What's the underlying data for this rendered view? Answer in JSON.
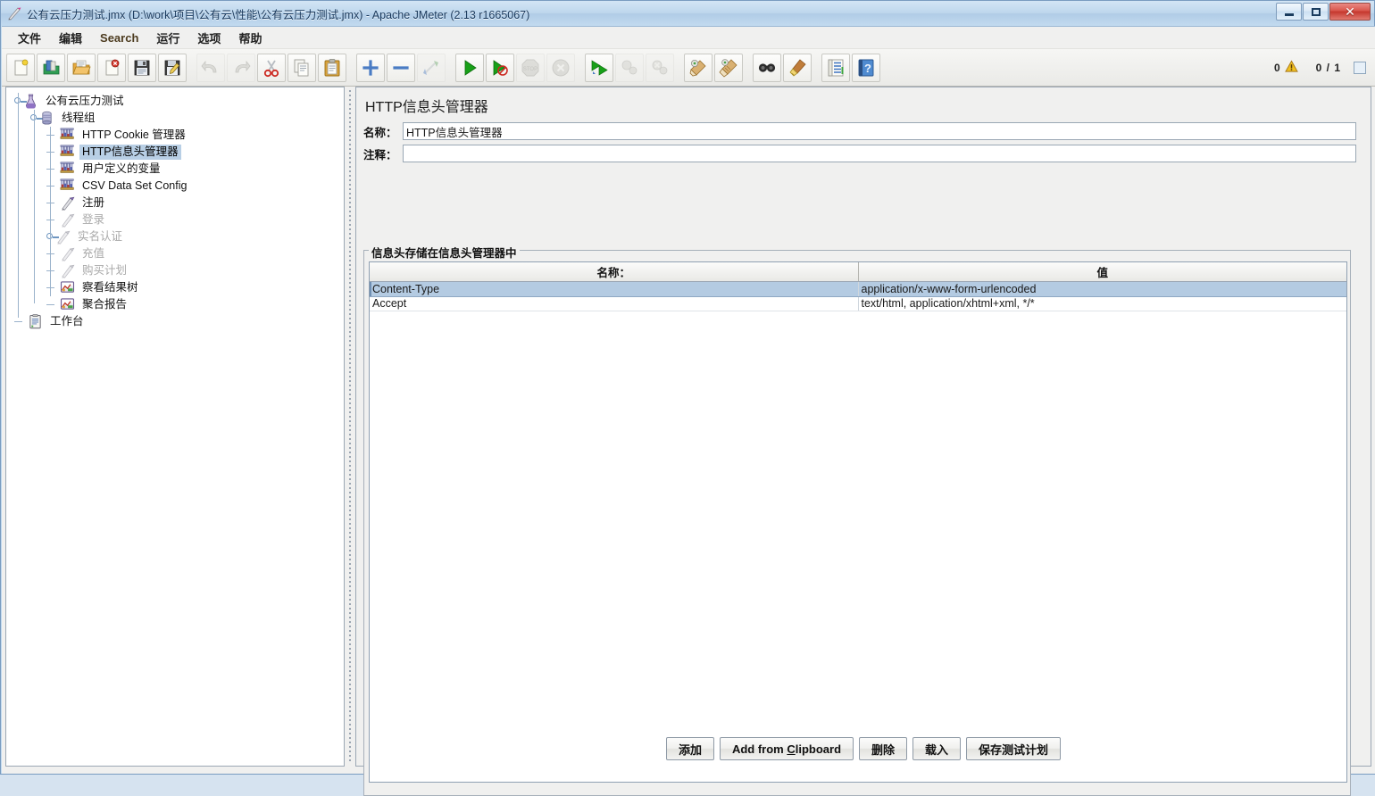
{
  "window": {
    "title": "公有云压力测试.jmx (D:\\work\\项目\\公有云\\性能\\公有云压力测试.jmx) - Apache JMeter (2.13 r1665067)",
    "minimize_label": "最小化",
    "maximize_label": "最大化",
    "close_label": "关闭"
  },
  "menubar": [
    {
      "label": "文件",
      "latin": false
    },
    {
      "label": "编辑",
      "latin": false
    },
    {
      "label": "Search",
      "latin": true
    },
    {
      "label": "运行",
      "latin": false
    },
    {
      "label": "选项",
      "latin": false
    },
    {
      "label": "帮助",
      "latin": false
    }
  ],
  "toolbar": {
    "buttons": [
      {
        "name": "new-icon",
        "disabled": false
      },
      {
        "name": "templates-icon",
        "disabled": false
      },
      {
        "name": "open-icon",
        "disabled": false
      },
      {
        "name": "close-icon",
        "disabled": false
      },
      {
        "name": "save-icon",
        "disabled": false
      },
      {
        "name": "save-as-icon",
        "disabled": false
      },
      {
        "name": "undo-icon",
        "disabled": true
      },
      {
        "name": "redo-icon",
        "disabled": true
      },
      {
        "name": "cut-icon",
        "disabled": false
      },
      {
        "name": "copy-icon",
        "disabled": false
      },
      {
        "name": "paste-icon",
        "disabled": false
      },
      {
        "name": "expand-all-icon",
        "disabled": false
      },
      {
        "name": "collapse-all-icon",
        "disabled": false
      },
      {
        "name": "toggle-icon",
        "disabled": true
      },
      {
        "name": "start-icon",
        "disabled": false
      },
      {
        "name": "start-no-timers-icon",
        "disabled": false
      },
      {
        "name": "stop-icon",
        "disabled": true
      },
      {
        "name": "shutdown-icon",
        "disabled": true
      },
      {
        "name": "remote-start-all-icon",
        "disabled": false
      },
      {
        "name": "remote-stop-all-icon",
        "disabled": true
      },
      {
        "name": "remote-shutdown-all-icon",
        "disabled": true
      },
      {
        "name": "clear-icon",
        "disabled": false
      },
      {
        "name": "clear-all-icon",
        "disabled": false
      },
      {
        "name": "search-icon",
        "disabled": false
      },
      {
        "name": "search-reset-icon",
        "disabled": false
      },
      {
        "name": "function-helper-icon",
        "disabled": false
      },
      {
        "name": "help-icon",
        "disabled": false
      }
    ],
    "status": {
      "warning_count": "0",
      "warning_icon": "warning-triangle-icon",
      "thread_count": "0 / 1"
    }
  },
  "tree": {
    "nodes": [
      {
        "label": "公有云压力测试",
        "icon": "test-plan-icon",
        "depth": 0,
        "expandable": true,
        "selected": false,
        "disabled": false
      },
      {
        "label": "线程组",
        "icon": "thread-group-icon",
        "depth": 1,
        "expandable": true,
        "selected": false,
        "disabled": false
      },
      {
        "label": "HTTP Cookie 管理器",
        "icon": "config-element-icon",
        "depth": 2,
        "expandable": false,
        "selected": false,
        "disabled": false
      },
      {
        "label": "HTTP信息头管理器",
        "icon": "config-element-icon",
        "depth": 2,
        "expandable": false,
        "selected": true,
        "disabled": false
      },
      {
        "label": "用户定义的变量",
        "icon": "config-element-icon",
        "depth": 2,
        "expandable": false,
        "selected": false,
        "disabled": false
      },
      {
        "label": "CSV Data Set Config",
        "icon": "config-element-icon",
        "depth": 2,
        "expandable": false,
        "selected": false,
        "disabled": false
      },
      {
        "label": "注册",
        "icon": "http-sampler-icon",
        "depth": 2,
        "expandable": false,
        "selected": false,
        "disabled": false
      },
      {
        "label": "登录",
        "icon": "http-sampler-icon",
        "depth": 2,
        "expandable": false,
        "selected": false,
        "disabled": true
      },
      {
        "label": "实名认证",
        "icon": "http-sampler-icon",
        "depth": 2,
        "expandable": true,
        "selected": false,
        "disabled": true
      },
      {
        "label": "充值",
        "icon": "http-sampler-icon",
        "depth": 2,
        "expandable": false,
        "selected": false,
        "disabled": true
      },
      {
        "label": "购买计划",
        "icon": "http-sampler-icon",
        "depth": 2,
        "expandable": false,
        "selected": false,
        "disabled": true
      },
      {
        "label": "察看结果树",
        "icon": "listener-icon",
        "depth": 2,
        "expandable": false,
        "selected": false,
        "disabled": false
      },
      {
        "label": "聚合报告",
        "icon": "listener-icon",
        "depth": 2,
        "expandable": false,
        "selected": false,
        "disabled": false
      },
      {
        "label": "工作台",
        "icon": "workbench-icon",
        "depth": 0,
        "expandable": false,
        "selected": false,
        "disabled": false
      }
    ]
  },
  "panel": {
    "title": "HTTP信息头管理器",
    "name_label": "名称：",
    "name_value": "HTTP信息头管理器",
    "comment_label": "注释：",
    "comment_value": "",
    "group_legend": "信息头存储在信息头管理器中",
    "table": {
      "columns": [
        "名称：",
        "值"
      ],
      "rows": [
        {
          "cells": [
            "Content-Type",
            "application/x-www-form-urlencoded"
          ],
          "selected": true
        },
        {
          "cells": [
            "Accept",
            "text/html, application/xhtml+xml, */*"
          ],
          "selected": false
        }
      ]
    },
    "buttons": [
      {
        "label": "添加",
        "mnemonic": ""
      },
      {
        "label": "Add from Clipboard",
        "mnemonic": "C"
      },
      {
        "label": "删除",
        "mnemonic": ""
      },
      {
        "label": "载入",
        "mnemonic": ""
      },
      {
        "label": "保存测试计划",
        "mnemonic": ""
      }
    ]
  },
  "colors": {
    "selection": "#b4cbe2",
    "titlebar": "#bdd6ec",
    "panel_bg": "#f0f0ef",
    "accent_text": "#4c3b1f"
  }
}
